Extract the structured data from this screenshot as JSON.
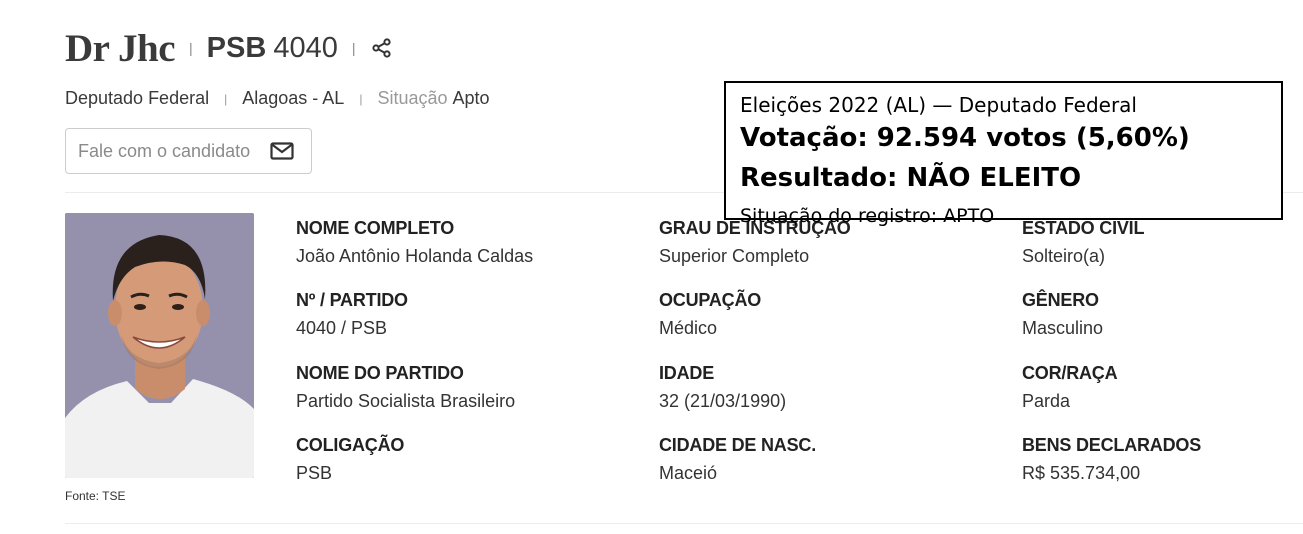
{
  "header": {
    "candidate_name": "Dr Jhc",
    "party_abbr": "PSB",
    "party_number": "4040",
    "share_icon": "share-icon"
  },
  "subheader": {
    "office": "Deputado Federal",
    "state": "Alagoas - AL",
    "status_label": "Situação",
    "status_value": "Apto"
  },
  "contact": {
    "label": "Fale com o candidato",
    "icon": "mail-icon"
  },
  "photo": {
    "credit": "Fonte: TSE",
    "background_color": "#9591ad"
  },
  "details": [
    {
      "label": "NOME COMPLETO",
      "value": "João Antônio Holanda Caldas"
    },
    {
      "label": "GRAU DE INSTRUÇÃO",
      "value": "Superior Completo"
    },
    {
      "label": "ESTADO CIVIL",
      "value": "Solteiro(a)"
    },
    {
      "label": "Nº / PARTIDO",
      "value": "4040 / PSB"
    },
    {
      "label": "OCUPAÇÃO",
      "value": "Médico"
    },
    {
      "label": "GÊNERO",
      "value": "Masculino"
    },
    {
      "label": "NOME DO PARTIDO",
      "value": "Partido Socialista Brasileiro"
    },
    {
      "label": "IDADE",
      "value": "32 (21/03/1990)"
    },
    {
      "label": "COR/RAÇA",
      "value": "Parda"
    },
    {
      "label": "COLIGAÇÃO",
      "value": "PSB"
    },
    {
      "label": "CIDADE DE NASC.",
      "value": "Maceió"
    },
    {
      "label": "BENS DECLARADOS",
      "value": "R$ 535.734,00"
    }
  ],
  "overlay": {
    "line1": "Eleições 2022 (AL) — Deputado Federal",
    "line2": "Votação: 92.594 votos (5,60%)",
    "line3": "Resultado: NÃO ELEITO",
    "line4": "Situação do registro: APTO"
  }
}
